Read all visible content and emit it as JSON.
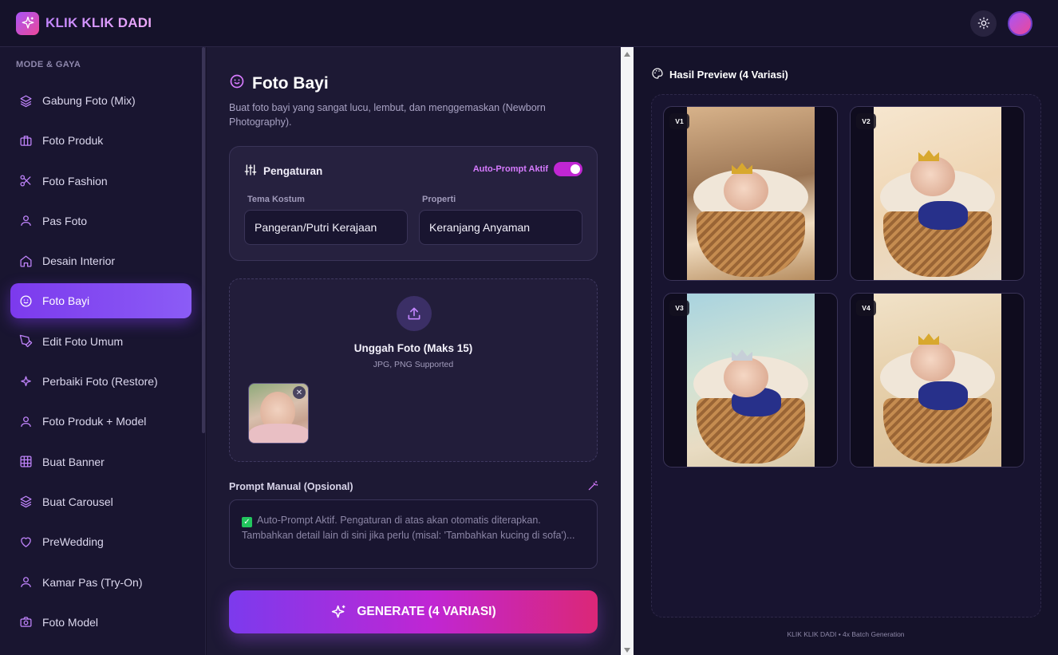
{
  "app": {
    "brand": "KLIK KLIK DADI"
  },
  "sidebar": {
    "section_title": "MODE & GAYA",
    "items": [
      {
        "label": "Gabung Foto (Mix)",
        "icon": "layers-icon"
      },
      {
        "label": "Foto Produk",
        "icon": "briefcase-icon"
      },
      {
        "label": "Foto Fashion",
        "icon": "scissors-icon"
      },
      {
        "label": "Pas Foto",
        "icon": "user-icon"
      },
      {
        "label": "Desain Interior",
        "icon": "home-icon"
      },
      {
        "label": "Foto Bayi",
        "icon": "baby-icon",
        "active": true
      },
      {
        "label": "Edit Foto Umum",
        "icon": "pen-icon"
      },
      {
        "label": "Perbaiki Foto (Restore)",
        "icon": "sparkle-icon"
      },
      {
        "label": "Foto Produk + Model",
        "icon": "user-icon"
      },
      {
        "label": "Buat Banner",
        "icon": "grid-icon"
      },
      {
        "label": "Buat Carousel",
        "icon": "layers-icon"
      },
      {
        "label": "PreWedding",
        "icon": "heart-icon"
      },
      {
        "label": "Kamar Pas (Try-On)",
        "icon": "user-icon"
      },
      {
        "label": "Foto Model",
        "icon": "camera-icon"
      }
    ]
  },
  "main": {
    "title": "Foto Bayi",
    "subtitle": "Buat foto bayi yang sangat lucu, lembut, dan menggemaskan (Newborn Photography).",
    "settings": {
      "title": "Pengaturan",
      "auto_prompt_label": "Auto-Prompt Aktif",
      "auto_prompt_on": true,
      "fields": [
        {
          "label": "Tema Kostum",
          "value": "Pangeran/Putri Kerajaan"
        },
        {
          "label": "Properti",
          "value": "Keranjang Anyaman"
        }
      ]
    },
    "upload": {
      "title": "Unggah Foto (Maks 15)",
      "subtitle": "JPG, PNG Supported"
    },
    "prompt": {
      "label": "Prompt Manual (Opsional)",
      "placeholder": "Auto-Prompt Aktif. Pengaturan di atas akan otomatis diterapkan. Tambahkan detail lain di sini jika perlu (misal: 'Tambahkan kucing di sofa')..."
    },
    "generate_label": "GENERATE (4 VARIASI)"
  },
  "preview": {
    "title": "Hasil Preview (4 Variasi)",
    "variants": [
      "V1",
      "V2",
      "V3",
      "V4"
    ],
    "footer": "KLIK KLIK DADI • 4x Batch Generation"
  },
  "colors": {
    "accent": "#7c3aed",
    "pink": "#db2777",
    "background": "#161229"
  }
}
